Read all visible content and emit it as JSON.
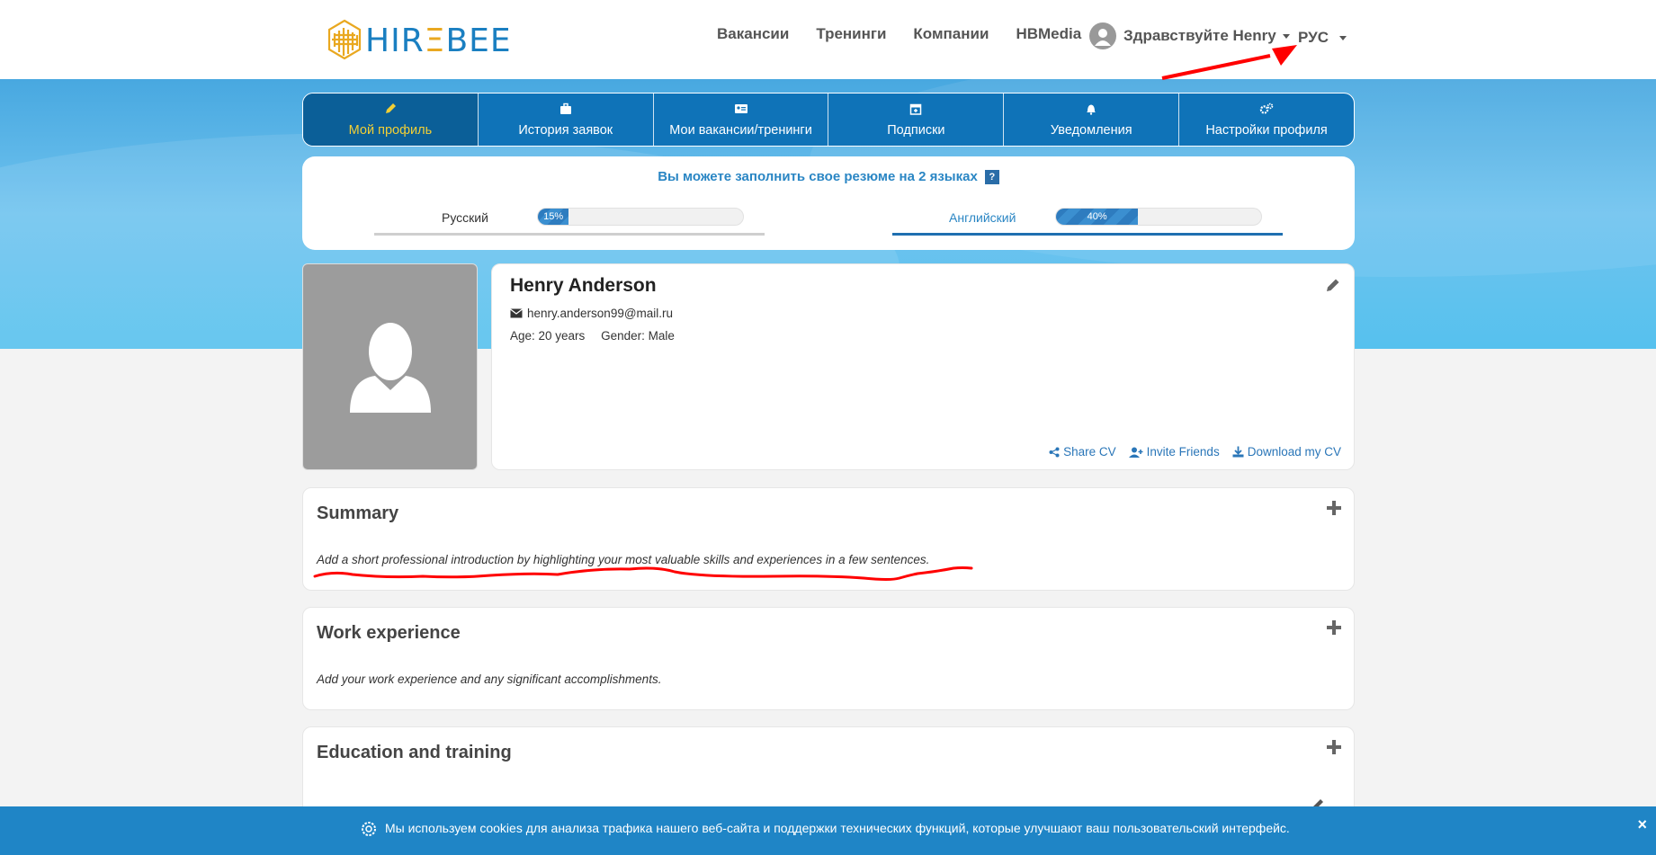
{
  "header": {
    "logo_left": "HIR",
    "logo_e": "Ξ",
    "logo_right": "BEE",
    "nav": [
      "Вакансии",
      "Тренинги",
      "Компании",
      "HBMedia"
    ],
    "greeting": "Здравствуйте Henry",
    "language": "РУС"
  },
  "tabs": [
    {
      "label": "Мой профиль",
      "icon": "pencil-icon",
      "active": true
    },
    {
      "label": "История заявок",
      "icon": "briefcase-icon"
    },
    {
      "label": "Мои вакансии/тренинги",
      "icon": "id-card-icon"
    },
    {
      "label": "Подписки",
      "icon": "calendar-plus-icon"
    },
    {
      "label": "Уведомления",
      "icon": "bell-icon"
    },
    {
      "label": "Настройки профиля",
      "icon": "gears-icon"
    }
  ],
  "resume_languages": {
    "title": "Вы можете заполнить свое резюме на 2 языках",
    "help": "?",
    "items": [
      {
        "name": "Русский",
        "percent_label": "15%",
        "progress": 0.15
      },
      {
        "name": "Английский",
        "percent_label": "40%",
        "progress": 0.4
      }
    ]
  },
  "profile": {
    "name": "Henry Anderson",
    "email": "henry.anderson99@mail.ru",
    "age": "Age: 20 years",
    "gender": "Gender: Male",
    "share": "Share CV",
    "invite": "Invite Friends",
    "download": "Download my CV"
  },
  "sections": {
    "summary": {
      "title": "Summary",
      "desc": "Add a short professional introduction by highlighting your most valuable skills and experiences in a few sentences."
    },
    "work": {
      "title": "Work experience",
      "desc": "Add your work experience and any significant accomplishments."
    },
    "education": {
      "title": "Education and training"
    }
  },
  "cookie": {
    "text": "Мы используем cookies для анализа трафика нашего веб-сайта и поддержки технических функций, которые улучшают ваш пользовательский интерфейс.",
    "close": "×"
  },
  "colors": {
    "brand_blue": "#0f73b8",
    "active_tab": "#0b5f98",
    "active_text": "#f2cf35",
    "annotation_red": "#ff0000"
  }
}
